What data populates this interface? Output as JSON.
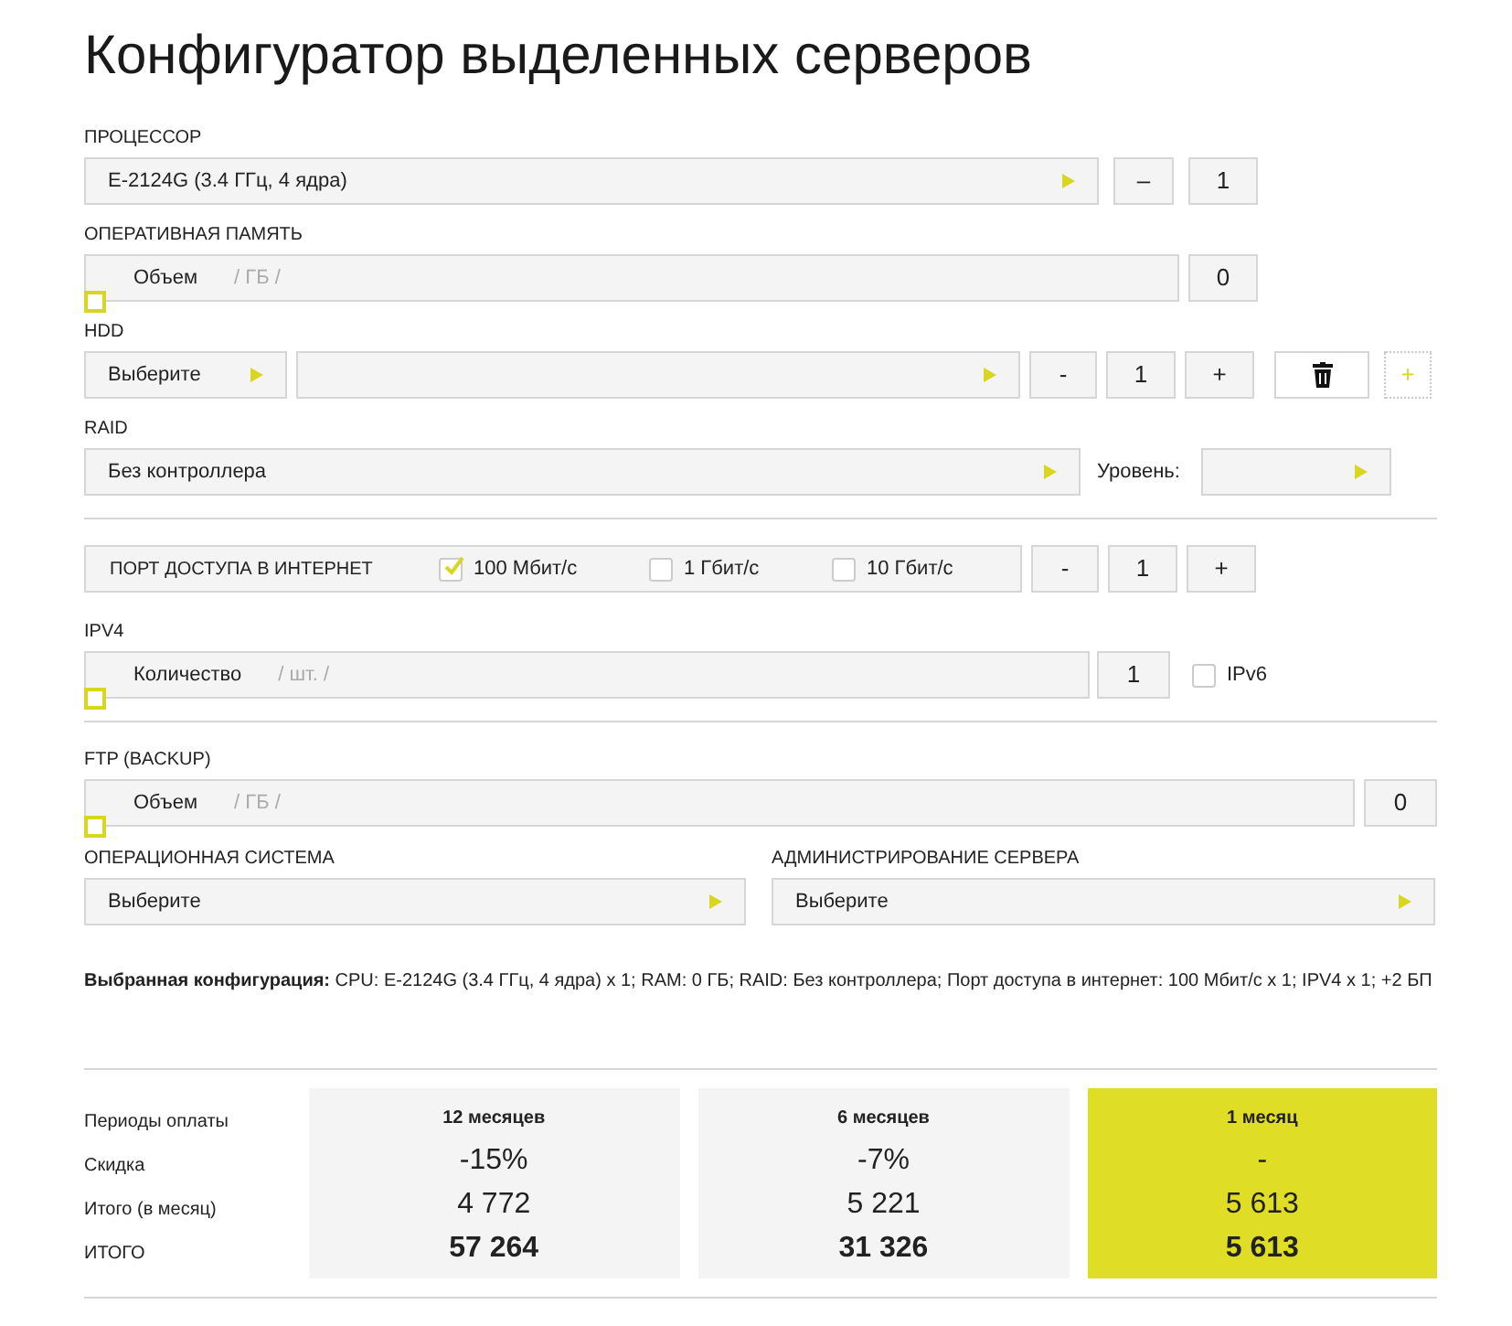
{
  "title": "Конфигуратор выделенных серверов",
  "cpu": {
    "label": "ПРОЦЕССОР",
    "value": "E-2124G (3.4 ГГц, 4 ядра)",
    "minus": "–",
    "count": "1"
  },
  "ram": {
    "label": "ОПЕРАТИВНАЯ ПАМЯТЬ",
    "field_label": "Объем",
    "unit": "/ ГБ /",
    "level": 0,
    "count": "0"
  },
  "hdd": {
    "label": "HDD",
    "type_value": "Выберите",
    "minus": "-",
    "count": "1",
    "plus": "+",
    "add": "+"
  },
  "raid": {
    "label": "RAID",
    "value": "Без контроллера",
    "level_label": "Уровень:"
  },
  "port": {
    "label": "ПОРТ ДОСТУПА В ИНТЕРНЕТ",
    "options": [
      {
        "label": "100 Мбит/с",
        "checked": true
      },
      {
        "label": "1 Гбит/с",
        "checked": false
      },
      {
        "label": "10 Гбит/с",
        "checked": false
      }
    ],
    "minus": "-",
    "count": "1",
    "plus": "+"
  },
  "ipv4": {
    "label": "IPV4",
    "field_label": "Количество",
    "unit": "/ шт. /",
    "level": 0,
    "count": "1",
    "ipv6": {
      "label": "IPv6",
      "checked": false
    }
  },
  "ftp": {
    "label": "FTP (BACKUP)",
    "field_label": "Объем",
    "unit": "/ ГБ /",
    "level": 0,
    "count": "0"
  },
  "os": {
    "label": "ОПЕРАЦИОННАЯ СИСТЕМА",
    "value": "Выберите"
  },
  "admin": {
    "label": "АДМИНИСТРИРОВАНИЕ СЕРВЕРА",
    "value": "Выберите"
  },
  "summary": "**Выбранная конфигурация:** CPU: E-2124G (3.4 ГГц, 4 ядра) x 1; RAM: 0 ГБ; RAID: Без контроллера; Порт доступа в интернет: 100 Мбит/с x 1; IPV4 x 1; +2 БП",
  "pricing": {
    "row_labels": [
      "Периоды оплаты",
      "Скидка",
      "Итого (в месяц)",
      "ИТОГО"
    ],
    "periods": [
      {
        "title": "12 месяцев",
        "discount": "-15%",
        "monthly": "4 772",
        "total": "57 264",
        "selected": false
      },
      {
        "title": "6 месяцев",
        "discount": "-7%",
        "monthly": "5 221",
        "total": "31 326",
        "selected": false
      },
      {
        "title": "1 месяц",
        "discount": "-",
        "monthly": "5 613",
        "total": "5 613",
        "selected": true
      }
    ]
  }
}
